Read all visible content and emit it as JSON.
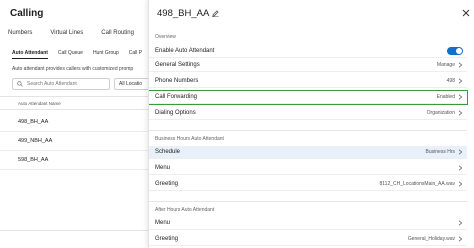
{
  "app": {
    "title": "Calling"
  },
  "tabs": [
    "Numbers",
    "Virtual Lines",
    "Call Routing"
  ],
  "subtabs": [
    "Auto Attendant",
    "Call Queue",
    "Hunt Group",
    "Call P"
  ],
  "left": {
    "description": "Auto attendant provides callers with customized promp",
    "search_placeholder": "Search Auto Attendant",
    "location_filter": "All Locatio",
    "column_header": "Auto Attendant Name",
    "rows": [
      "498_BH_AA",
      "499_NBH_AA",
      "598_BH_AA"
    ]
  },
  "panel": {
    "title": "498_BH_AA",
    "overview_label": "Overview",
    "enable_label": "Enable Auto Attendant",
    "enabled": true,
    "general_settings": {
      "label": "General Settings",
      "value": "Manage"
    },
    "phone_numbers": {
      "label": "Phone Numbers",
      "value": "498"
    },
    "call_forwarding": {
      "label": "Call Forwarding",
      "value": "Enabled"
    },
    "dialing_options": {
      "label": "Dialing Options",
      "value": "Organization"
    },
    "business_hours_label": "Business Hours Auto Attendant",
    "schedule": {
      "label": "Schedule",
      "value": "Business Hrs"
    },
    "bh_menu": {
      "label": "Menu",
      "value": ""
    },
    "bh_greeting": {
      "label": "Greeting",
      "value": "8112_CH_LocationsMain_AA.wav"
    },
    "after_hours_label": "After Hours Auto Attendant",
    "ah_menu": {
      "label": "Menu",
      "value": ""
    },
    "ah_greeting": {
      "label": "Greeting",
      "value": "General_Holiday.wav"
    }
  },
  "colors": {
    "accent": "#1170cf",
    "highlight_border": "#3a9a3a",
    "selected_row": "#e8f1fa"
  }
}
